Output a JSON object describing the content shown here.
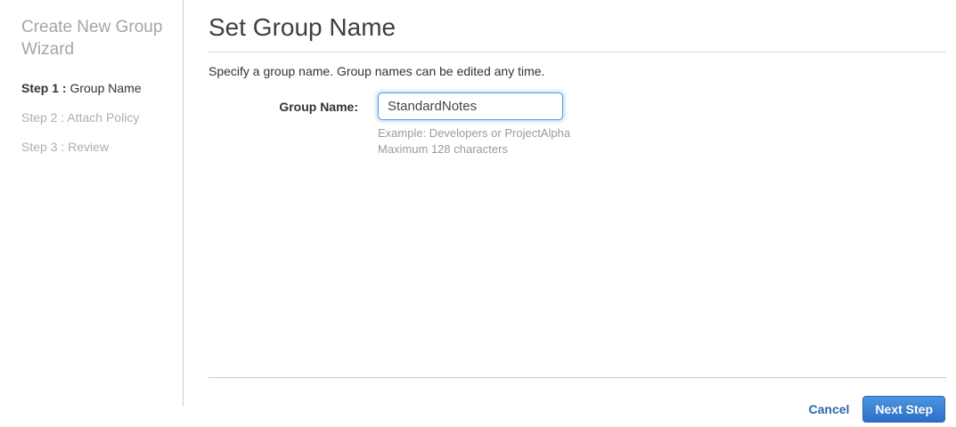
{
  "sidebar": {
    "title": "Create New Group Wizard",
    "steps": [
      {
        "prefix": "Step 1 :",
        "label": "Group Name",
        "state": "active"
      },
      {
        "prefix": "Step 2 :",
        "label": "Attach Policy",
        "state": "upcoming"
      },
      {
        "prefix": "Step 3 :",
        "label": "Review",
        "state": "upcoming"
      }
    ]
  },
  "main": {
    "title": "Set Group Name",
    "description": "Specify a group name. Group names can be edited any time.",
    "form": {
      "label": "Group Name:",
      "value": "StandardNotes",
      "hint_example": "Example: Developers or ProjectAlpha",
      "hint_max": "Maximum 128 characters"
    },
    "footer": {
      "cancel_label": "Cancel",
      "next_label": "Next Step"
    }
  },
  "colors": {
    "accent_button_top": "#4c96e0",
    "accent_button_bottom": "#2d6fc8",
    "link_blue": "#2b66ad",
    "focus_border_blue": "#5b9dd9",
    "muted_gray": "#9b9b9b",
    "divider_gray": "#cccccc",
    "text_dark": "#333333"
  }
}
